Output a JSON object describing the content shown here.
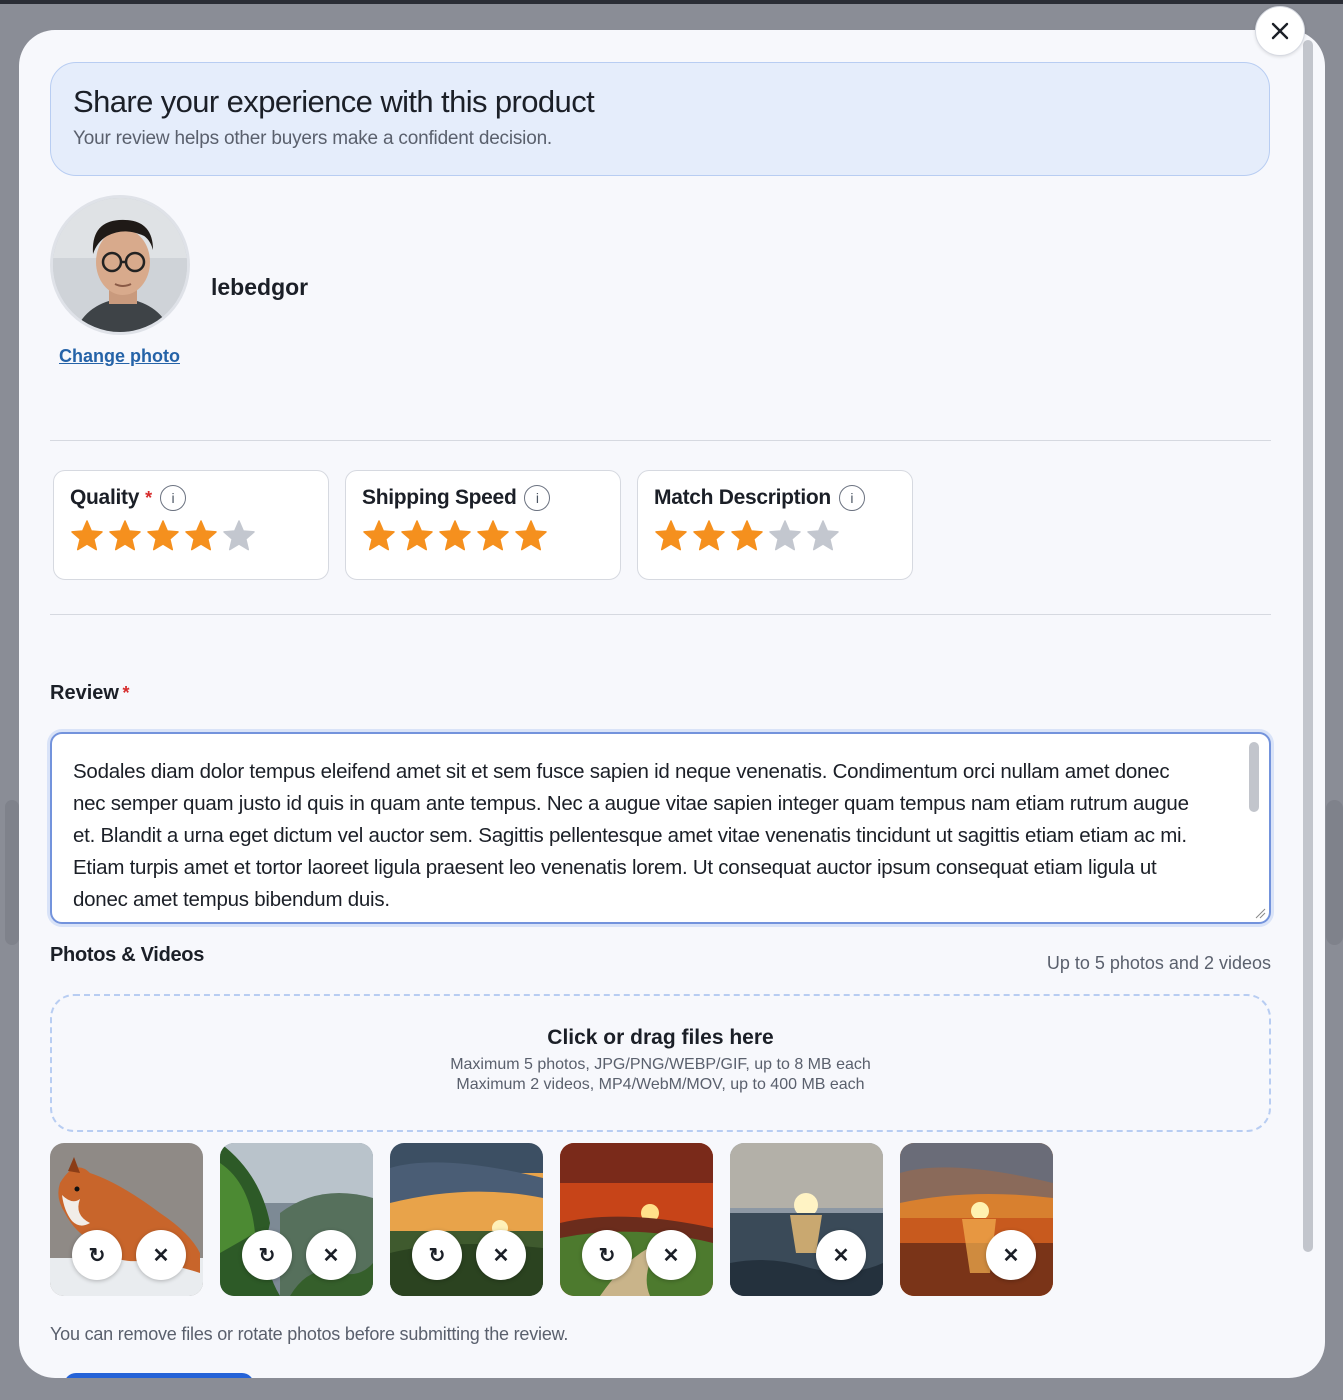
{
  "modal": {
    "close_icon": "close-icon",
    "hero": {
      "title": "Share your experience with this product",
      "subtitle": "Your review helps other buyers make a confident decision."
    },
    "profile": {
      "username": "lebedgor",
      "change_photo_label": "Change photo"
    },
    "ratings": [
      {
        "label": "Quality",
        "required": "*",
        "stars": 4,
        "max": 5
      },
      {
        "label": "Shipping Speed",
        "required": "",
        "stars": 5,
        "max": 5
      },
      {
        "label": "Match Description",
        "required": "",
        "stars": 3,
        "max": 5
      }
    ],
    "review": {
      "label": "Review",
      "required": "*",
      "text": "Sodales diam dolor tempus eleifend amet sit et sem fusce sapien id neque venenatis. Condimentum orci nullam amet donec nec semper quam justo id quis in quam ante tempus. Nec a augue vitae sapien integer quam tempus nam etiam rutrum augue et. Blandit a urna eget dictum vel auctor sem. Sagittis pellentesque amet vitae venenatis tincidunt ut sagittis etiam etiam ac mi. Etiam turpis amet et tortor laoreet ligula praesent leo venenatis lorem. Ut consequat auctor ipsum consequat etiam ligula ut donec amet tempus bibendum duis."
    },
    "media": {
      "label": "Photos & Videos",
      "limit": "Up to 5 photos and 2 videos",
      "dropzone_title": "Click or drag files here",
      "dropzone_line1": "Maximum 5 photos, JPG/PNG/WEBP/GIF, up to 8 MB each",
      "dropzone_line2": "Maximum 2 videos, MP4/WebM/MOV, up to 400 MB each",
      "items": [
        {
          "subject": "fox",
          "rotatable": true
        },
        {
          "subject": "forest-valley",
          "rotatable": true
        },
        {
          "subject": "sunset-meadow",
          "rotatable": true
        },
        {
          "subject": "sunset-hills",
          "rotatable": true
        },
        {
          "subject": "sea-sunset",
          "rotatable": false
        },
        {
          "subject": "orange-sea-sunset",
          "rotatable": false
        }
      ],
      "rotate_glyph": "↻",
      "remove_glyph": "✕",
      "hint": "You can remove files or rotate photos before submitting the review."
    },
    "colors": {
      "accent": "#2563a8",
      "star_filled": "#f5901e",
      "star_empty": "#c3c7cf",
      "required": "#d62b2b"
    }
  }
}
